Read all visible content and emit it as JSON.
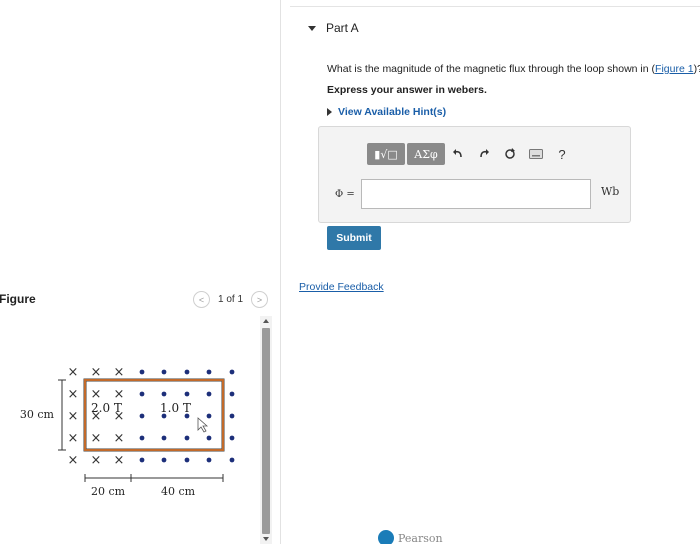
{
  "part": {
    "title": "Part A"
  },
  "question": {
    "text": "What is the magnitude of the magnetic flux through the loop shown in ",
    "link_open": "(",
    "link": "Figure 1",
    "link_close": ")?",
    "instruction": "Express your answer in webers.",
    "hints_label": "View Available Hint(s)"
  },
  "answer": {
    "toolbar": {
      "template_label": "▮√□",
      "greek_label": "ΑΣφ",
      "help_label": "?"
    },
    "symbol_label": "Φ =",
    "value": "",
    "unit": "Wb"
  },
  "submit_label": "Submit",
  "feedback_label": "Provide Feedback",
  "figure": {
    "label": "Figure",
    "pager": {
      "prev": "<",
      "text": "1 of 1",
      "next": ">"
    },
    "field_left_label": "2.0 T",
    "field_right_label": "1.0 T",
    "height_label": "30 cm",
    "width_left_label": "20 cm",
    "width_right_label": "40 cm"
  },
  "footer": {
    "brand": "Pearson"
  },
  "colors": {
    "link": "#1a5ea8",
    "submit": "#2f78a8",
    "loop": "#c26a2a",
    "toolbar_button": "#8a8a8a"
  }
}
